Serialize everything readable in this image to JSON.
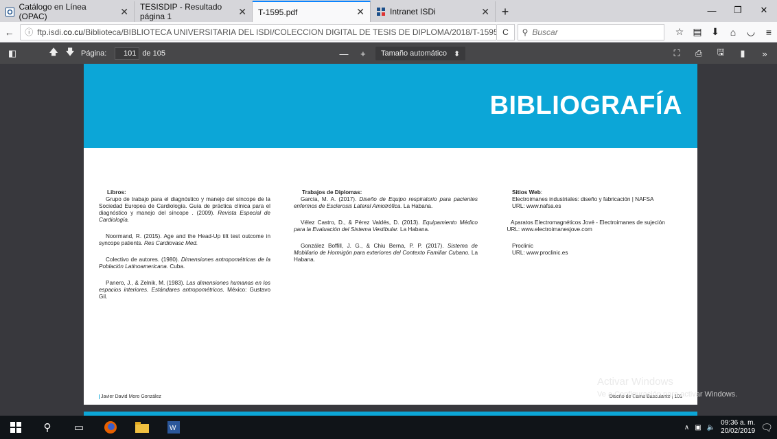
{
  "tabs": [
    {
      "label": "Catálogo en Línea (OPAC)",
      "icon": "opac-icon"
    },
    {
      "label": "TESISDIP - Resultado página 1",
      "icon": ""
    },
    {
      "label": "T-1595.pdf",
      "icon": "",
      "active": true
    },
    {
      "label": "Intranet ISDi",
      "icon": "isdi-icon"
    }
  ],
  "url": {
    "prefix": "ftp.isdi.",
    "domain": "co.cu",
    "path": "/Biblioteca/BIBLIOTECA UNIVERSITARIA DEL ISDI/COLECCION DIGITAL DE TESIS DE DIPLOMA/2018/T-1595/"
  },
  "search": {
    "placeholder": "Buscar"
  },
  "pdf": {
    "page_label": "Página:",
    "page": "101",
    "of": "de 105",
    "zoom": "Tamaño automático"
  },
  "doc": {
    "title": "BIBLIOGRAFÍA",
    "col1_head": "Libros:",
    "col2_head": "Trabajos de Diplomas:",
    "col3_head": "Sitios Web",
    "footer_left": "Javier David Moro González",
    "footer_right": "Diseño de Cama Basculante | 101"
  },
  "watermark": {
    "line1": "Activar Windows",
    "line2": "Ve a Configuración para activar Windows."
  },
  "clock": {
    "time": "09:36 a. m.",
    "date": "20/02/2019"
  },
  "colors": {
    "accent": "#0ca6d7"
  }
}
